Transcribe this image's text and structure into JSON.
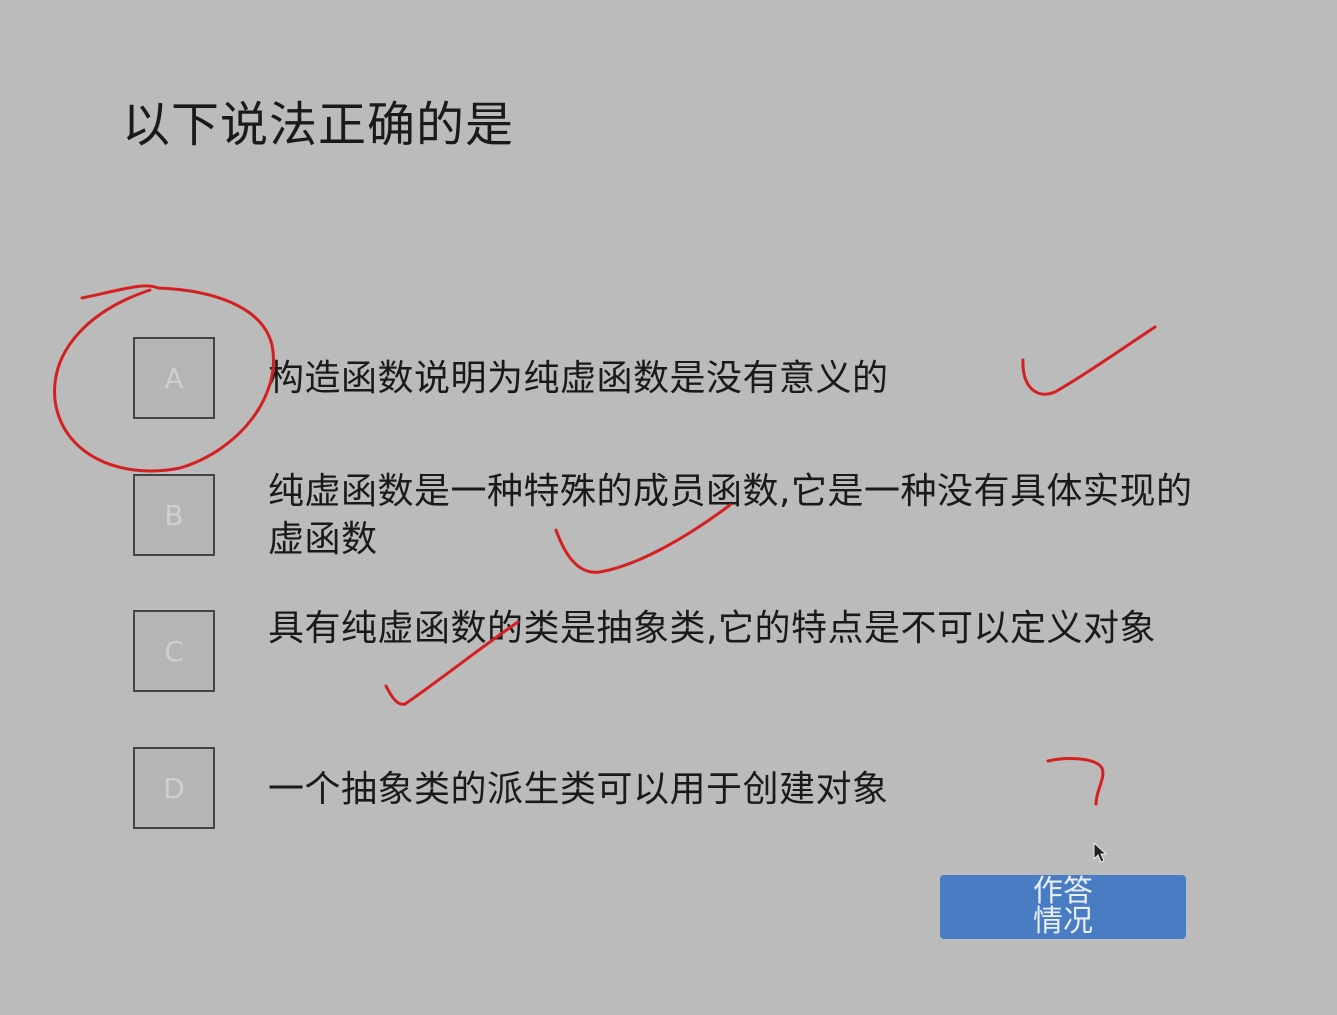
{
  "question": {
    "title": "以下说法正确的是"
  },
  "options": [
    {
      "letter": "A",
      "text": "构造函数说明为纯虚函数是没有意义的"
    },
    {
      "letter": "B",
      "text": "纯虚函数是一种特殊的成员函数,它是一种没有具体实现的虚函数"
    },
    {
      "letter": "C",
      "text": "具有纯虚函数的类是抽象类,它的特点是不可以定义对象"
    },
    {
      "letter": "D",
      "text": "一个抽象类的派生类可以用于创建对象"
    }
  ],
  "footer": {
    "answer_status_label": "作答情况"
  },
  "colors": {
    "background": "#bbbbbb",
    "button": "#4a7cc4",
    "annotation_ink": "#d42020"
  },
  "icons": {
    "cursor": "mouse-pointer-icon"
  }
}
